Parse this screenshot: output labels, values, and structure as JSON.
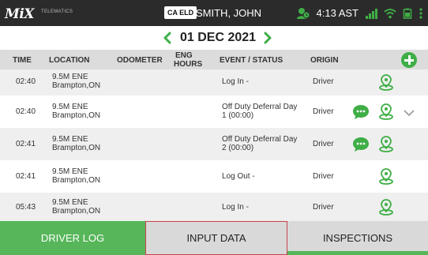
{
  "status_bar": {
    "logo": "MiX",
    "logo_sub": "TELEMATICS",
    "eld_badge": "CA ELD",
    "driver_name": "SMITH, JOHN",
    "time": "4:13 AST"
  },
  "date_nav": {
    "date": "01 DEC 2021"
  },
  "table": {
    "headers": {
      "time": "TIME",
      "location": "LOCATION",
      "odometer": "ODOMETER",
      "eng_hours_1": "ENG",
      "eng_hours_2": "HOURS",
      "event_status": "EVENT / STATUS",
      "origin": "ORIGIN"
    },
    "rows": [
      {
        "time": "02:40",
        "loc1": "9.5M ENE",
        "loc2": "Brampton,ON",
        "event1": "Log In -",
        "event2": "",
        "origin": "Driver",
        "has_comment": false,
        "has_chevron": false
      },
      {
        "time": "02:40",
        "loc1": "9.5M ENE",
        "loc2": "Brampton,ON",
        "event1": "Off Duty Deferral Day",
        "event2": "1 (00:00)",
        "origin": "Driver",
        "has_comment": true,
        "has_chevron": true
      },
      {
        "time": "02:41",
        "loc1": "9.5M ENE",
        "loc2": "Brampton,ON",
        "event1": "Off Duty Deferral Day",
        "event2": "2 (00:00)",
        "origin": "Driver",
        "has_comment": true,
        "has_chevron": false
      },
      {
        "time": "02:41",
        "loc1": "9.5M ENE",
        "loc2": "Brampton,ON",
        "event1": "Log Out -",
        "event2": "",
        "origin": "Driver",
        "has_comment": false,
        "has_chevron": false
      },
      {
        "time": "05:43",
        "loc1": "9.5M ENE",
        "loc2": "Brampton,ON",
        "event1": "Log In -",
        "event2": "",
        "origin": "Driver",
        "has_comment": false,
        "has_chevron": false
      }
    ]
  },
  "tabs": {
    "driver_log": "DRIVER LOG",
    "input_data": "INPUT DATA",
    "inspections": "INSPECTIONS"
  },
  "colors": {
    "accent_green": "#57b65a",
    "selected_border": "#c8414b",
    "status_bar_bg": "#2b2b2b"
  },
  "icons": [
    "add-icon",
    "comment-icon",
    "location-pin-icon",
    "chevron-down-icon",
    "arrow-left-icon",
    "arrow-right-icon",
    "wifi-icon",
    "signal-icon",
    "battery-icon",
    "menu-icon"
  ]
}
